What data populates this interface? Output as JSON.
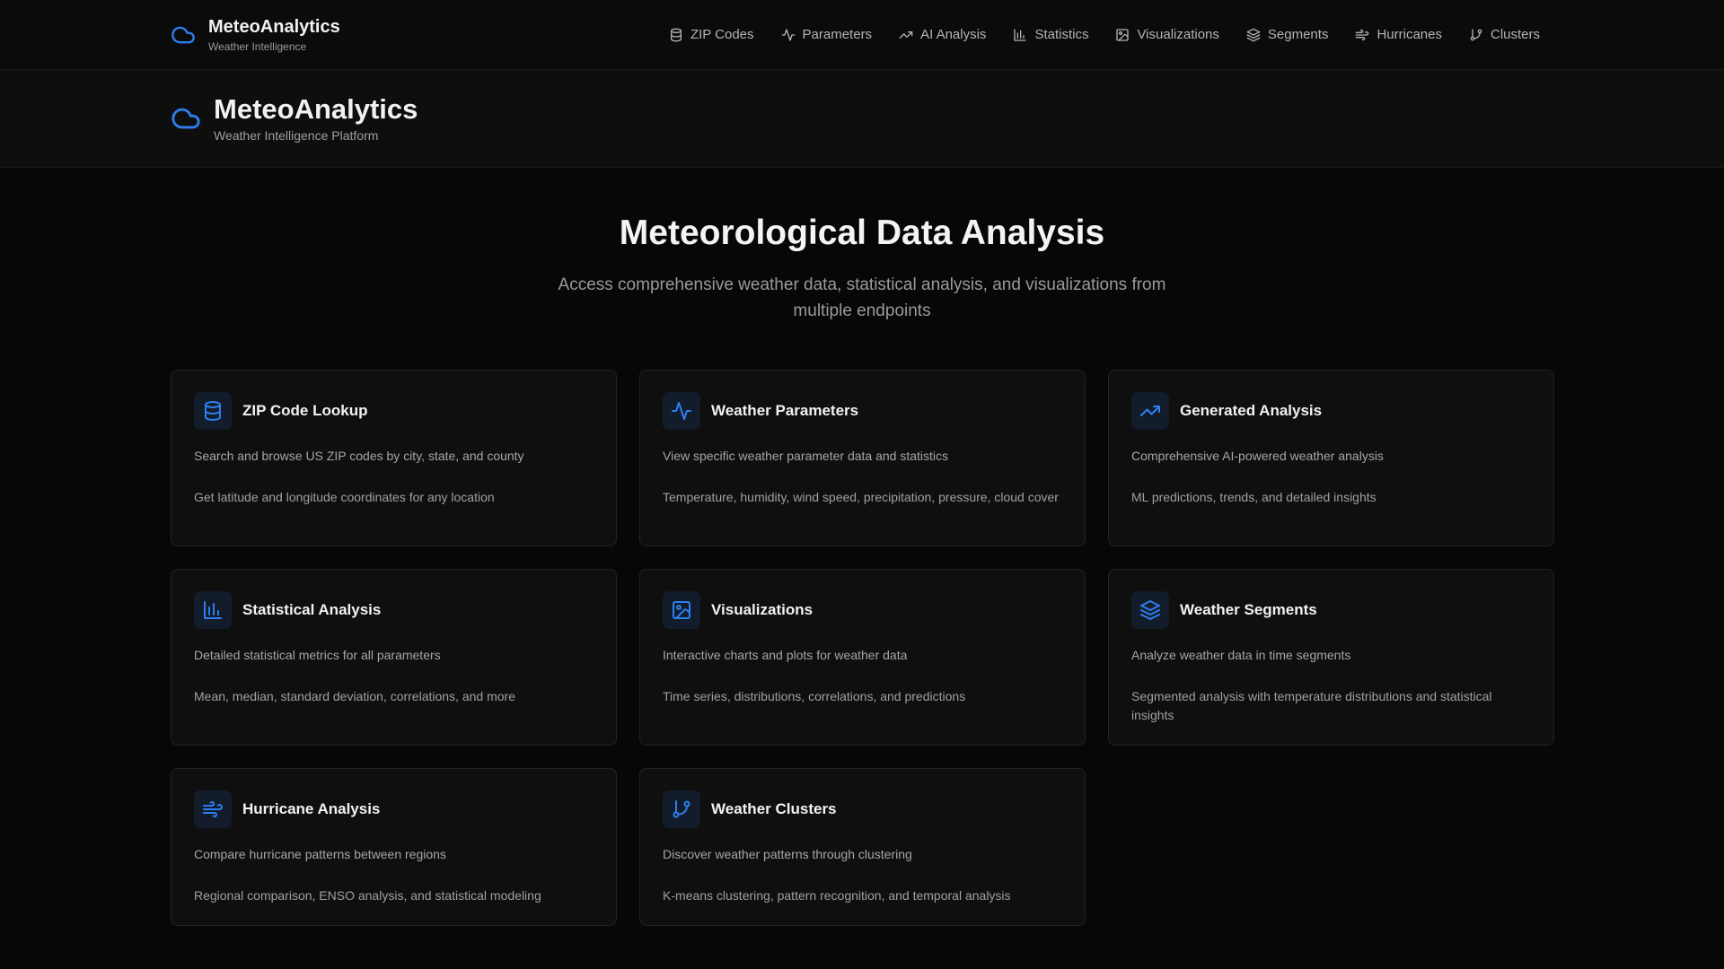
{
  "topnav": {
    "brand_title": "MeteoAnalytics",
    "brand_subtitle": "Weather Intelligence",
    "logo_icon": "cloud-icon",
    "items": [
      {
        "label": "ZIP Codes",
        "icon": "database-icon"
      },
      {
        "label": "Parameters",
        "icon": "activity-icon"
      },
      {
        "label": "AI Analysis",
        "icon": "trending-up-icon"
      },
      {
        "label": "Statistics",
        "icon": "bar-chart-icon"
      },
      {
        "label": "Visualizations",
        "icon": "image-icon"
      },
      {
        "label": "Segments",
        "icon": "layers-icon"
      },
      {
        "label": "Hurricanes",
        "icon": "wind-icon"
      },
      {
        "label": "Clusters",
        "icon": "git-branch-icon"
      }
    ]
  },
  "subheader": {
    "title": "MeteoAnalytics",
    "subtitle": "Weather Intelligence Platform",
    "logo_icon": "cloud-icon"
  },
  "hero": {
    "title": "Meteorological Data Analysis",
    "description": "Access comprehensive weather data, statistical analysis, and visualizations from multiple endpoints"
  },
  "cards": [
    {
      "title": "ZIP Code Lookup",
      "description": "Search and browse US ZIP codes by city, state, and county",
      "detail": "Get latitude and longitude coordinates for any location",
      "icon": "database-icon"
    },
    {
      "title": "Weather Parameters",
      "description": "View specific weather parameter data and statistics",
      "detail": "Temperature, humidity, wind speed, precipitation, pressure, cloud cover",
      "icon": "activity-icon"
    },
    {
      "title": "Generated Analysis",
      "description": "Comprehensive AI-powered weather analysis",
      "detail": "ML predictions, trends, and detailed insights",
      "icon": "trending-up-icon"
    },
    {
      "title": "Statistical Analysis",
      "description": "Detailed statistical metrics for all parameters",
      "detail": "Mean, median, standard deviation, correlations, and more",
      "icon": "bar-chart-icon"
    },
    {
      "title": "Visualizations",
      "description": "Interactive charts and plots for weather data",
      "detail": "Time series, distributions, correlations, and predictions",
      "icon": "image-icon"
    },
    {
      "title": "Weather Segments",
      "description": "Analyze weather data in time segments",
      "detail": "Segmented analysis with temperature distributions and statistical insights",
      "icon": "layers-icon"
    },
    {
      "title": "Hurricane Analysis",
      "description": "Compare hurricane patterns between regions",
      "detail": "Regional comparison, ENSO analysis, and statistical modeling",
      "icon": "wind-icon"
    },
    {
      "title": "Weather Clusters",
      "description": "Discover weather patterns through clustering",
      "detail": "K-means clustering, pattern recognition, and temporal analysis",
      "icon": "git-branch-icon"
    }
  ],
  "colors": {
    "accent": "#2d7ff0",
    "background": "#070707",
    "card_background": "#0f0f0f",
    "icon_tile": "#121c2b"
  }
}
